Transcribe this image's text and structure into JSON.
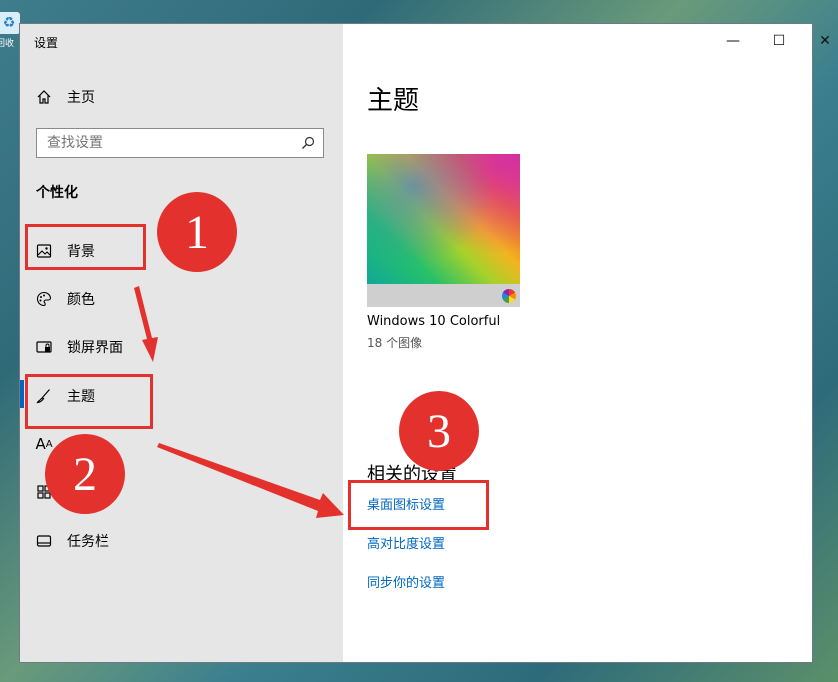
{
  "desktop": {
    "icon_label": "回收"
  },
  "window": {
    "title": "设置",
    "controls": {
      "minimize": "—",
      "maximize": "☐",
      "close": "✕"
    }
  },
  "sidebar": {
    "home": "主页",
    "search_placeholder": "查找设置",
    "section": "个性化",
    "items": [
      {
        "label": "背景",
        "icon": "image-icon"
      },
      {
        "label": "颜色",
        "icon": "palette-icon"
      },
      {
        "label": "锁屏界面",
        "icon": "lock-screen-icon"
      },
      {
        "label": "主题",
        "icon": "brush-icon"
      },
      {
        "label": "",
        "icon": "font-icon"
      },
      {
        "label": "",
        "icon": "start-icon"
      },
      {
        "label": "任务栏",
        "icon": "taskbar-icon"
      }
    ]
  },
  "content": {
    "heading": "主题",
    "theme": {
      "name": "Windows 10 Colorful",
      "count": "18 个图像"
    },
    "related_title": "相关的设置",
    "links": [
      "桌面图标设置",
      "高对比度设置",
      "同步你的设置"
    ]
  },
  "annotations": {
    "badges": [
      "1",
      "2",
      "3"
    ],
    "color": "#e3322d"
  },
  "colors": {
    "accent": "#0067c0",
    "sidebar_bg": "#e6e6e6"
  }
}
